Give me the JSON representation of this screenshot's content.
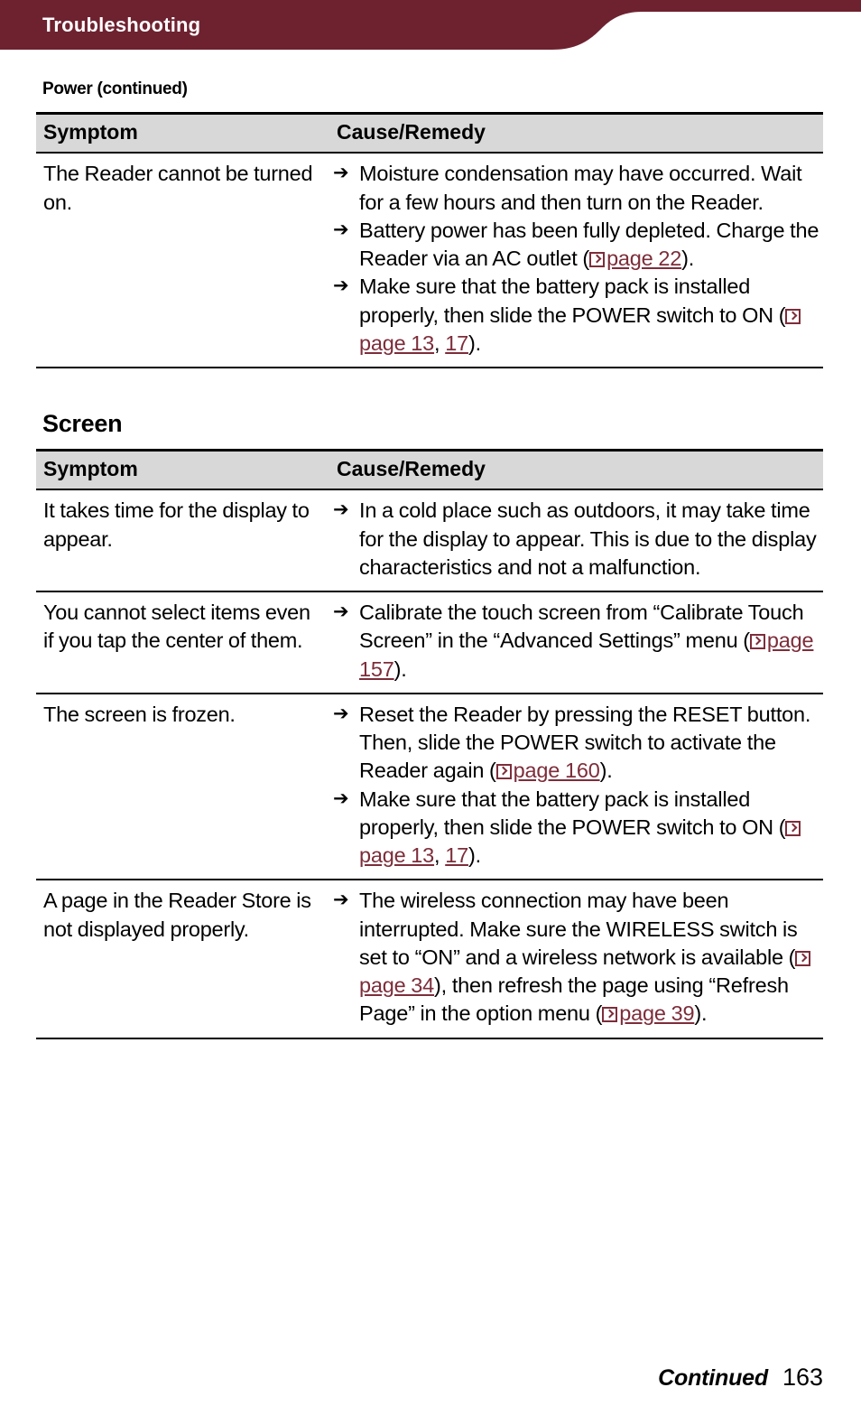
{
  "header": {
    "title": "Troubleshooting",
    "band_color": "#6e2230"
  },
  "link_color": "#7d2d3a",
  "icons": {
    "bullet_arrow": "arrow-right-bullet",
    "page_ref": "page-reference-icon"
  },
  "sections": [
    {
      "heading": "Power (continued)",
      "columns": {
        "symptom": "Symptom",
        "remedy": "Cause/Remedy"
      },
      "rows": [
        {
          "symptom": "The Reader cannot be turned on.",
          "remedies": [
            {
              "parts": [
                {
                  "t": "text",
                  "v": "Moisture condensation may have occurred. Wait for a few hours and then turn on the Reader."
                }
              ]
            },
            {
              "parts": [
                {
                  "t": "text",
                  "v": "Battery power has been fully depleted. Charge the Reader via an AC outlet ("
                },
                {
                  "t": "icon",
                  "v": "page-reference-icon"
                },
                {
                  "t": "link",
                  "v": "page 22"
                },
                {
                  "t": "text",
                  "v": ")."
                }
              ]
            },
            {
              "parts": [
                {
                  "t": "text",
                  "v": "Make sure that the battery pack is installed properly, then slide the POWER switch to ON ("
                },
                {
                  "t": "icon",
                  "v": "page-reference-icon"
                },
                {
                  "t": "link",
                  "v": "page 13"
                },
                {
                  "t": "text",
                  "v": ", "
                },
                {
                  "t": "link",
                  "v": "17"
                },
                {
                  "t": "text",
                  "v": ")."
                }
              ]
            }
          ]
        }
      ]
    },
    {
      "heading": "Screen",
      "columns": {
        "symptom": "Symptom",
        "remedy": "Cause/Remedy"
      },
      "rows": [
        {
          "symptom": "It takes time for the display to appear.",
          "remedies": [
            {
              "parts": [
                {
                  "t": "text",
                  "v": "In a cold place such as outdoors, it may take time for the display to appear. This is due to the display characteristics and not a malfunction."
                }
              ]
            }
          ]
        },
        {
          "symptom": "You cannot select items even if you tap the center of them.",
          "remedies": [
            {
              "parts": [
                {
                  "t": "text",
                  "v": "Calibrate the touch screen from “Calibrate Touch Screen” in the “Advanced Settings” menu ("
                },
                {
                  "t": "icon",
                  "v": "page-reference-icon"
                },
                {
                  "t": "link",
                  "v": "page 157"
                },
                {
                  "t": "text",
                  "v": ")."
                }
              ]
            }
          ]
        },
        {
          "symptom": "The screen is frozen.",
          "remedies": [
            {
              "parts": [
                {
                  "t": "text",
                  "v": "Reset the Reader by pressing the RESET button. Then, slide the POWER switch to activate the Reader again ("
                },
                {
                  "t": "icon",
                  "v": "page-reference-icon"
                },
                {
                  "t": "link",
                  "v": "page 160"
                },
                {
                  "t": "text",
                  "v": ")."
                }
              ]
            },
            {
              "parts": [
                {
                  "t": "text",
                  "v": "Make sure that the battery pack is installed properly, then slide the POWER switch to ON ("
                },
                {
                  "t": "icon",
                  "v": "page-reference-icon"
                },
                {
                  "t": "link",
                  "v": "page 13"
                },
                {
                  "t": "text",
                  "v": ", "
                },
                {
                  "t": "link",
                  "v": "17"
                },
                {
                  "t": "text",
                  "v": ")."
                }
              ]
            }
          ]
        },
        {
          "symptom": "A page in the Reader Store is not displayed properly.",
          "remedies": [
            {
              "parts": [
                {
                  "t": "text",
                  "v": "The wireless connection may have been interrupted. Make sure the WIRELESS switch is set to “ON” and a wireless network is available ("
                },
                {
                  "t": "icon",
                  "v": "page-reference-icon"
                },
                {
                  "t": "link",
                  "v": "page 34"
                },
                {
                  "t": "text",
                  "v": "), then refresh the page using “Refresh Page” in the option menu ("
                },
                {
                  "t": "icon",
                  "v": "page-reference-icon"
                },
                {
                  "t": "link",
                  "v": "page 39"
                },
                {
                  "t": "text",
                  "v": ")."
                }
              ]
            }
          ]
        }
      ]
    }
  ],
  "footer": {
    "continued": "Continued",
    "page_number": "163"
  }
}
